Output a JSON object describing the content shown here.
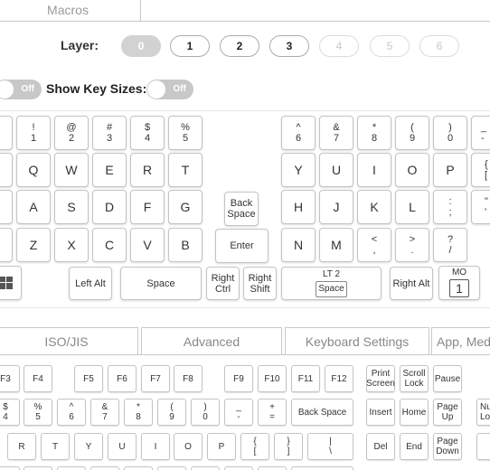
{
  "top_tab": {
    "label": "Macros"
  },
  "layers": {
    "label": "Layer:",
    "items": [
      "0",
      "1",
      "2",
      "3",
      "4",
      "5",
      "6"
    ]
  },
  "toggles": {
    "first": {
      "state": "Off"
    },
    "show_key_sizes": {
      "label": "Show Key Sizes:",
      "state": "Off"
    }
  },
  "keyboard": {
    "num_row": [
      [
        "",
        "!",
        "1"
      ],
      [
        "",
        "@",
        "2"
      ],
      [
        "",
        "#",
        "3"
      ],
      [
        "",
        "$",
        "4"
      ],
      [
        "",
        "%",
        "5"
      ],
      [
        "",
        "^",
        "6"
      ],
      [
        "",
        "&",
        "7"
      ],
      [
        "",
        "*",
        "8"
      ],
      [
        "",
        "(",
        "9"
      ],
      [
        "",
        ")",
        "0"
      ],
      [
        "",
        "_",
        "-"
      ]
    ],
    "letters": {
      "row_q": [
        "Q",
        "W",
        "E",
        "R",
        "T",
        "Y",
        "U",
        "I",
        "O",
        "P"
      ],
      "row_a": [
        "A",
        "S",
        "D",
        "F",
        "G",
        "H",
        "J",
        "K",
        "L"
      ],
      "row_z": [
        "Z",
        "X",
        "C",
        "V",
        "B",
        "N",
        "M"
      ]
    },
    "symbols": {
      "bracket": [
        "{",
        "["
      ],
      "semicolon": [
        ":",
        ";"
      ],
      "quote": [
        "\"",
        "'"
      ],
      "comma": [
        "<",
        ","
      ],
      "period": [
        ">",
        "."
      ],
      "slash": [
        "?",
        "/"
      ]
    },
    "backspace": [
      "Back",
      "Space"
    ],
    "enter": "Enter",
    "left_alt": "Left Alt",
    "space": "Space",
    "right_ctrl": [
      "Right",
      "Ctrl"
    ],
    "right_shift": [
      "Right",
      "Shift"
    ],
    "lt2": {
      "top": "LT 2",
      "bottom": "Space"
    },
    "right_alt": "Right Alt",
    "mo": {
      "top": "MO",
      "bottom": "1"
    },
    "windows_icon": "windows-logo-icon"
  },
  "section_tabs": [
    "ISO/JIS",
    "Advanced",
    "Keyboard Settings",
    "App, Med"
  ],
  "picker": {
    "fkeys": [
      "F3",
      "F4",
      "F5",
      "F6",
      "F7",
      "F8",
      "F9",
      "F10",
      "F11",
      "F12"
    ],
    "print_screen": [
      "Print",
      "Screen"
    ],
    "scroll_lock": [
      "Scroll",
      "Lock"
    ],
    "pause": "Pause",
    "num_row": [
      [
        "$",
        "4"
      ],
      [
        "%",
        "5"
      ],
      [
        "^",
        "6"
      ],
      [
        "&",
        "7"
      ],
      [
        "*",
        "8"
      ],
      [
        "(",
        "9"
      ],
      [
        ")",
        "0"
      ],
      [
        "_",
        "-"
      ],
      [
        "+",
        "="
      ]
    ],
    "back_space": "Back Space",
    "insert": "Insert",
    "home": "Home",
    "page_up": [
      "Page",
      "Up"
    ],
    "num_partial": [
      "Nu",
      "Lo"
    ],
    "qrow": [
      "R",
      "T",
      "Y",
      "U",
      "I",
      "O",
      "P"
    ],
    "brace_open": [
      "{",
      "["
    ],
    "brace_close": [
      "}",
      "]"
    ],
    "pipe": [
      "|",
      "\\"
    ],
    "del": "Del",
    "end": "End",
    "page_down": [
      "Page",
      "Down"
    ]
  }
}
